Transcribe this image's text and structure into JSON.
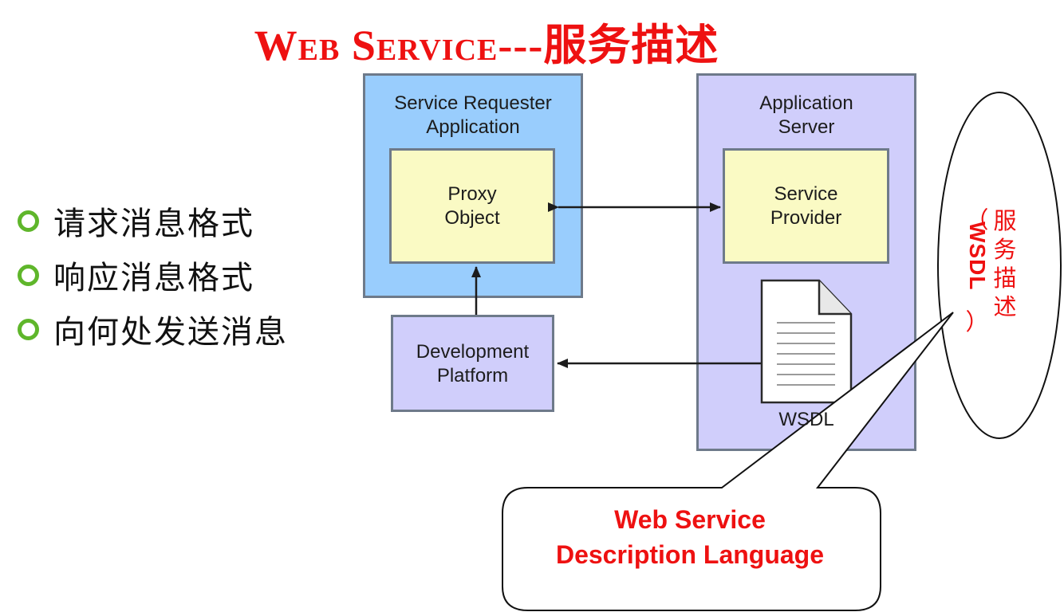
{
  "title": {
    "prefix": "Web Service",
    "suffix": "---服务描述"
  },
  "bullets": [
    {
      "text": "请求消息格式"
    },
    {
      "text": "响应消息格式"
    },
    {
      "text": "向何处发送消息"
    }
  ],
  "diagram": {
    "requester_label": "Service Requester\nApplication",
    "proxy_label": "Proxy\nObject",
    "appserver_label": "Application\nServer",
    "provider_label": "Service\nProvider",
    "devplatform_label": "Development\nPlatform",
    "wsdl_doc_label": "WSDL"
  },
  "side_note": {
    "open_paren": "（",
    "chars": [
      "服",
      "务",
      "描",
      "述"
    ],
    "wsdl": "WSDL",
    "close_paren": "）"
  },
  "callout": {
    "line1": "Web Service",
    "line2": "Description Language"
  },
  "colors": {
    "accent_red": "#ee1111",
    "bullet_green": "#5fb62b",
    "blue_box": "#99cdfd",
    "lavender_box": "#d0cefb",
    "yellow_box": "#fafac4"
  }
}
